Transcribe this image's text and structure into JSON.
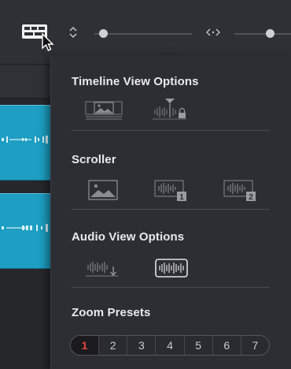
{
  "toolbar": {
    "timeline_view_button_icon": "timeline-view-options-icon",
    "track_height_icon": "track-height-updown-icon",
    "track_height_slider_value": 0.05,
    "zoom_icon": "code-brackets-icon",
    "zoom_slider_value": 0.65
  },
  "sections": {
    "timeline_view": {
      "title": "Timeline View Options"
    },
    "scroller": {
      "title": "Scroller"
    },
    "audio_view": {
      "title": "Audio View Options"
    },
    "zoom_presets": {
      "title": "Zoom Presets"
    }
  },
  "zoom_presets": {
    "buttons": [
      "1",
      "2",
      "3",
      "4",
      "5",
      "6",
      "7"
    ],
    "active_index": 0
  },
  "colors": {
    "panel_bg": "#2d2e33",
    "clip": "#1d9ec2",
    "active_zoom": "#e5453c",
    "text": "#e9e9ec"
  }
}
